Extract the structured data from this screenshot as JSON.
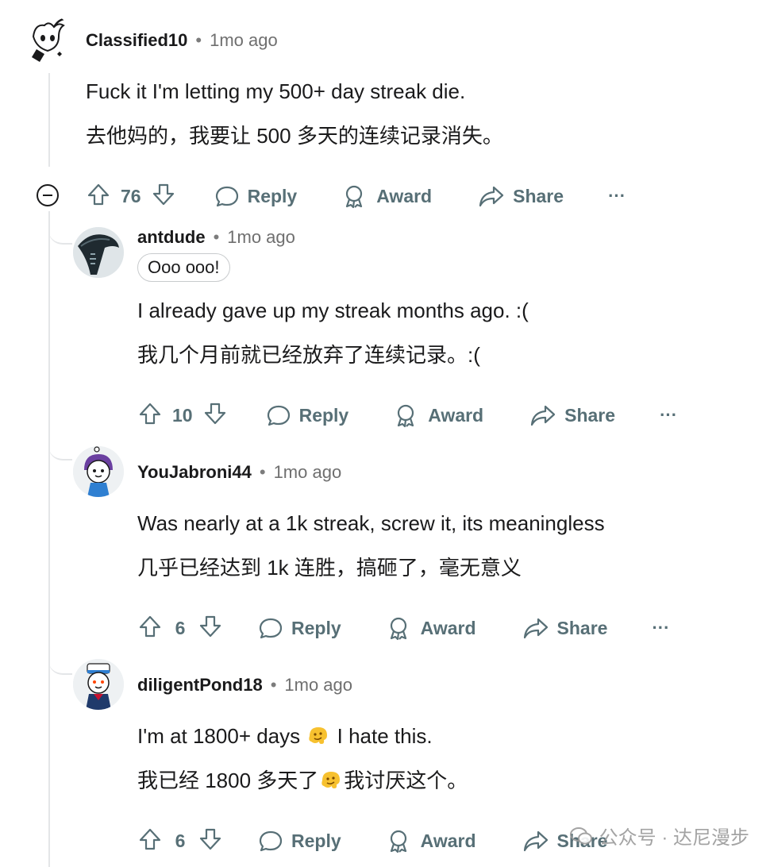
{
  "comments": [
    {
      "username": "Classified10",
      "time": "1mo ago",
      "line_en": "Fuck it I'm letting my 500+ day streak die.",
      "line_zh": "去他妈的，我要让 500 多天的连续记录消失。",
      "votes": "76"
    },
    {
      "username": "antdude",
      "time": "1mo ago",
      "flair": "Ooo ooo!",
      "line_en": "I already gave up my streak months ago. :(",
      "line_zh": "我几个月前就已经放弃了连续记录。:(",
      "votes": "10"
    },
    {
      "username": "YouJabroni44",
      "time": "1mo ago",
      "line_en": "Was nearly at a 1k streak, screw it, its meaningless",
      "line_zh": "几乎已经达到 1k 连胜，搞砸了，毫无意义",
      "votes": "6"
    },
    {
      "username": "diligentPond18",
      "time": "1mo ago",
      "line_en_a": "I'm at 1800+ days",
      "line_en_b": "I hate this.",
      "line_zh_a": "我已经 1800 多天了",
      "line_zh_b": "我讨厌这个。",
      "votes": "6"
    }
  ],
  "actions": {
    "reply": "Reply",
    "award": "Award",
    "share": "Share",
    "more": "···"
  },
  "icons": [
    "collapse-icon",
    "upvote-icon",
    "downvote-icon",
    "reply-icon",
    "award-icon",
    "share-icon",
    "more-icon",
    "melting-face-emoji"
  ],
  "watermark": {
    "text": "公众号 · 达尼漫步"
  },
  "colors": {
    "text": "#1a1a1b",
    "action": "#576f76",
    "meta": "#6f6f6f",
    "thread_line": "#e4e6e8"
  }
}
